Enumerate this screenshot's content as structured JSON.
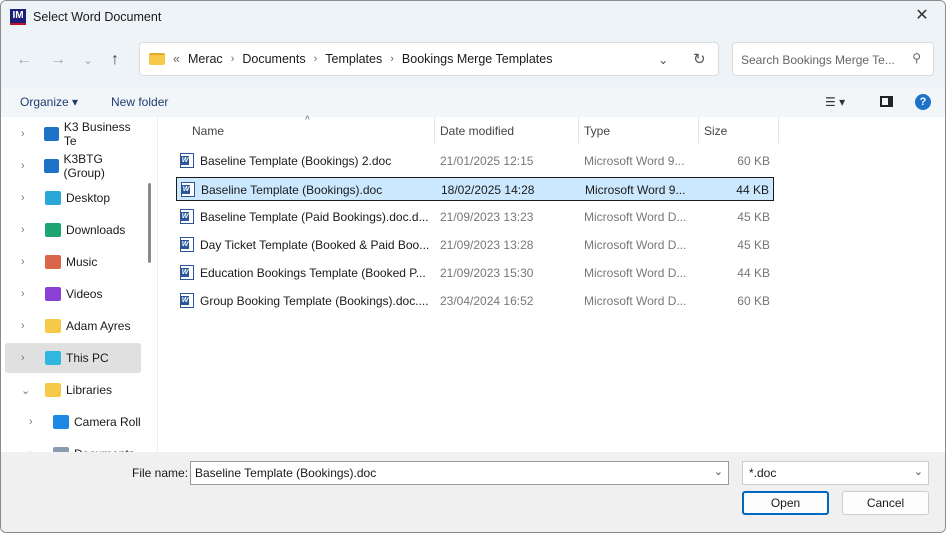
{
  "window": {
    "title": "Select Word Document",
    "app_icon": "IM",
    "close": "✕"
  },
  "nav": {
    "back": "←",
    "forward": "→",
    "recent": "⌄",
    "up": "↑",
    "breadcrumb": [
      "Merac",
      "Documents",
      "Templates",
      "Bookings Merge Templates"
    ],
    "overflow": "«",
    "search_placeholder": "Search Bookings Merge Te..."
  },
  "toolbar": {
    "organize": "Organize ▾",
    "new_folder": "New folder"
  },
  "sidebar": {
    "items": [
      {
        "label": "K3 Business Te",
        "icon": "building-icon",
        "color": "#1e73c9",
        "chevron": "›"
      },
      {
        "label": "K3BTG (Group)",
        "icon": "building-icon",
        "color": "#1e73c9",
        "chevron": "›"
      },
      {
        "label": "Desktop",
        "icon": "desktop-icon",
        "color": "#2aa7d8",
        "chevron": "›"
      },
      {
        "label": "Downloads",
        "icon": "download-icon",
        "color": "#1ea672",
        "chevron": "›"
      },
      {
        "label": "Music",
        "icon": "music-icon",
        "color": "#d9654a",
        "chevron": "›"
      },
      {
        "label": "Videos",
        "icon": "video-icon",
        "color": "#8a3fd6",
        "chevron": "›"
      },
      {
        "label": "Adam Ayres",
        "icon": "folder-icon",
        "color": "#f7c948",
        "chevron": "›"
      },
      {
        "label": "This PC",
        "icon": "computer-icon",
        "color": "#30b7e0",
        "chevron": "›",
        "selected": true
      },
      {
        "label": "Libraries",
        "icon": "folder-icon",
        "color": "#f7c948",
        "chevron": "⌄"
      },
      {
        "label": "Camera Roll",
        "icon": "pictures-icon",
        "color": "#1e88e5",
        "chevron": "›",
        "indent": true
      },
      {
        "label": "Documents",
        "icon": "document-icon",
        "color": "#8a9ab0",
        "chevron": "›",
        "indent": true
      }
    ]
  },
  "columns": [
    "Name",
    "Date modified",
    "Type",
    "Size"
  ],
  "files": [
    {
      "name": "Baseline Template (Bookings) 2.doc",
      "date": "21/01/2025 12:15",
      "type": "Microsoft Word 9...",
      "size": "60 KB"
    },
    {
      "name": "Baseline Template (Bookings).doc",
      "date": "18/02/2025 14:28",
      "type": "Microsoft Word 9...",
      "size": "44 KB",
      "selected": true
    },
    {
      "name": "Baseline Template (Paid Bookings).doc.d...",
      "date": "21/09/2023 13:23",
      "type": "Microsoft Word D...",
      "size": "45 KB"
    },
    {
      "name": "Day Ticket Template (Booked & Paid Boo...",
      "date": "21/09/2023 13:28",
      "type": "Microsoft Word D...",
      "size": "45 KB"
    },
    {
      "name": "Education Bookings Template (Booked P...",
      "date": "21/09/2023 15:30",
      "type": "Microsoft Word D...",
      "size": "44 KB"
    },
    {
      "name": "Group Booking Template (Bookings).doc....",
      "date": "23/04/2024 16:52",
      "type": "Microsoft Word D...",
      "size": "60 KB"
    }
  ],
  "footer": {
    "file_name_label": "File name:",
    "file_name": "Baseline Template (Bookings).doc",
    "file_type": "*.doc",
    "open": "Open",
    "cancel": "Cancel"
  }
}
